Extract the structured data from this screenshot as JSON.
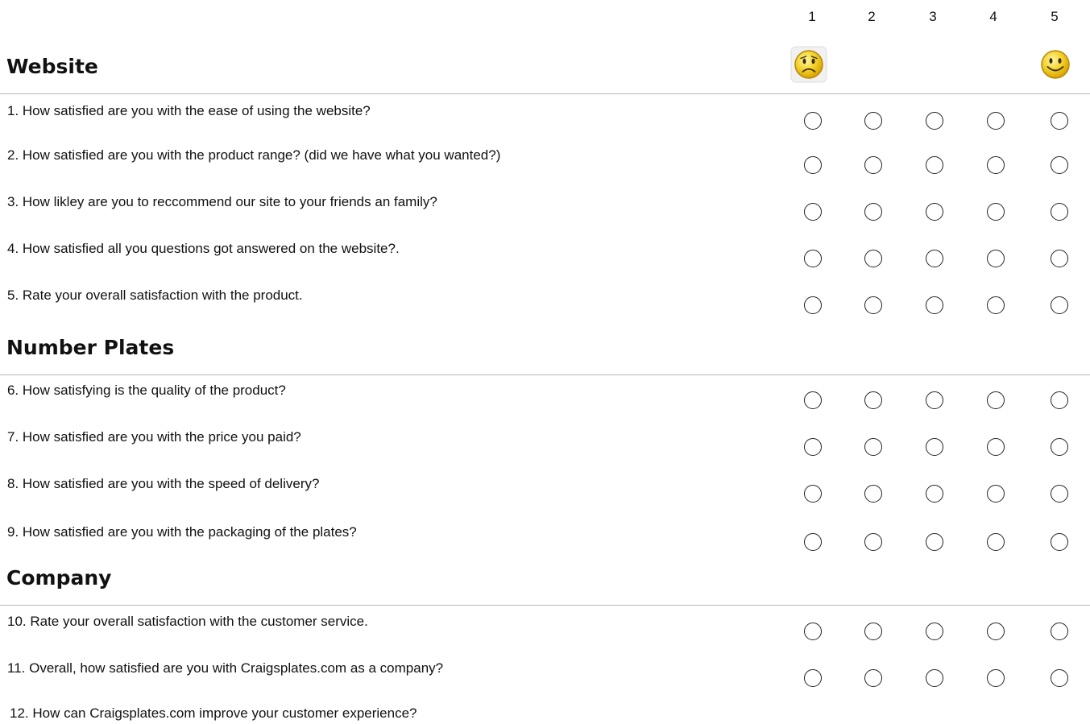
{
  "scale": {
    "labels": [
      "1",
      "2",
      "3",
      "4",
      "5"
    ],
    "low_icon": "sad-face-icon",
    "high_icon": "happy-face-icon"
  },
  "sections": [
    {
      "title": "Website",
      "questions": [
        "1. How satisfied are you with the  ease of using the website?",
        "2. How satisfied are you with the product range? (did we have what you wanted?)",
        "3. How likley are you to reccommend our site to your friends an family?",
        "4. How satisfied all you questions got answered on the website?.",
        "5. Rate your overall satisfaction with the product."
      ]
    },
    {
      "title": "Number Plates",
      "questions": [
        "6. How satisfying is the quality of the product?",
        "7. How satisfied are you with the price you paid?",
        "8. How satisfied are you with the speed of delivery?",
        "9. How satisfied are you with the packaging of the plates?"
      ]
    },
    {
      "title": "Company",
      "questions": [
        "10. Rate your overall satisfaction with the customer service.",
        "11. Overall, how satisfied are you with Craigsplates.com as a company?"
      ]
    }
  ],
  "open_question": "12. How can Craigsplates.com improve your customer experience?",
  "colors": {
    "face_fill": "#f2d22a",
    "face_outline": "#b8860b",
    "rule": "#b8b8b8",
    "radio_border": "#222222"
  }
}
